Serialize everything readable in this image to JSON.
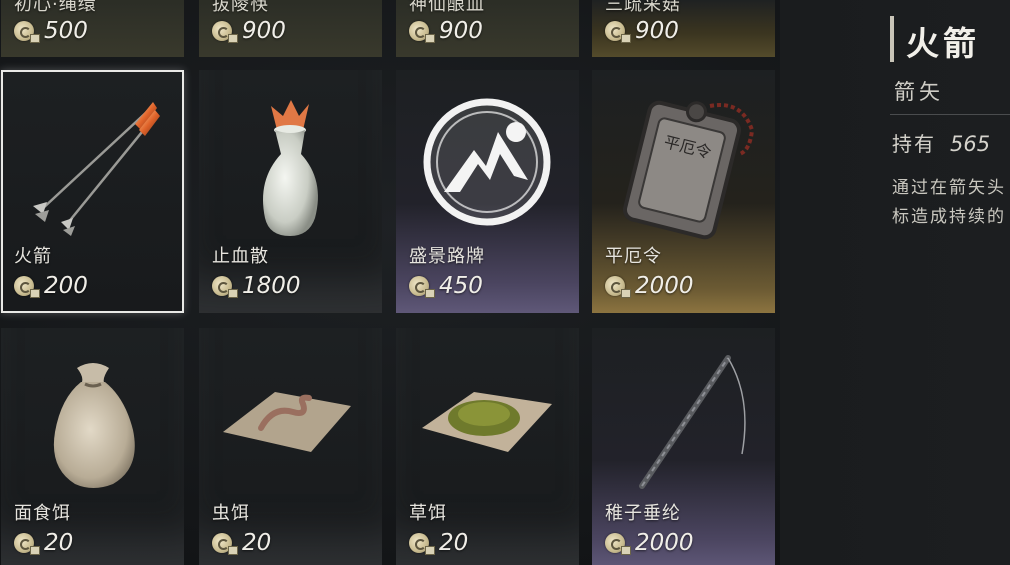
{
  "top_row": [
    {
      "name": "初心·绳缳",
      "price": "500"
    },
    {
      "name": "拔陵筷",
      "price": "900"
    },
    {
      "name": "神仙酿血",
      "price": "900"
    },
    {
      "name": "三疏采菇",
      "price": "900"
    }
  ],
  "items": [
    {
      "name": "火箭",
      "price": "200"
    },
    {
      "name": "止血散",
      "price": "1800"
    },
    {
      "name": "盛景路牌",
      "price": "450"
    },
    {
      "name": "平厄令",
      "price": "2000"
    },
    {
      "name": "面食饵",
      "price": "20"
    },
    {
      "name": "虫饵",
      "price": "20"
    },
    {
      "name": "草饵",
      "price": "20"
    },
    {
      "name": "稚子垂纶",
      "price": "2000"
    }
  ],
  "token_engraving": "平厄令",
  "detail": {
    "title": "火箭",
    "category": "箭矢",
    "own_label": "持有",
    "own_value": "565",
    "desc_line1": "通过在箭矢头",
    "desc_line2": "标造成持续的"
  },
  "colors": {
    "gold_tier": "#8c7440",
    "purple_tier": "#5f5878",
    "selected_border": "#e9e9e6"
  },
  "icons": {
    "currency": "coin-icon",
    "selected_item": "fire-arrow-icon"
  }
}
